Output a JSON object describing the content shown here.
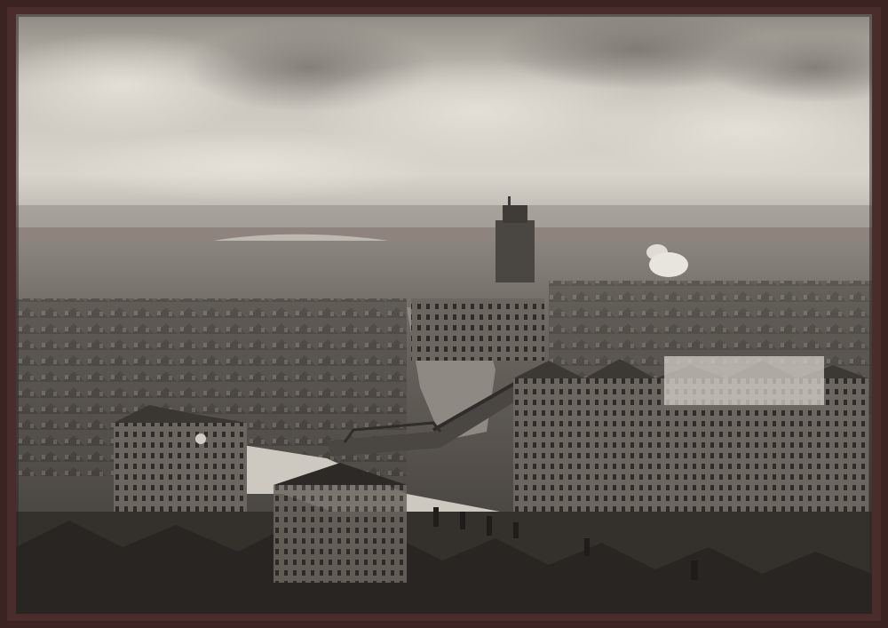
{
  "image": {
    "kind": "framed sepia photograph",
    "subject_icon": "cityscape-photo",
    "colors": {
      "frame": "#3b2322",
      "sky_light": "#dcd8d0",
      "sky_dark": "#8d8880",
      "water": "#b9b5ad",
      "roofs_dark": "#3a3734",
      "roofs_mid": "#5e5a55",
      "street": "#cfcac2"
    }
  }
}
